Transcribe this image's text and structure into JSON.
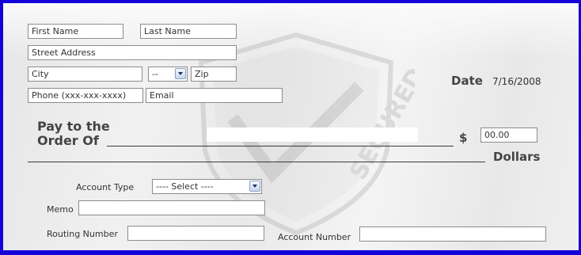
{
  "form": {
    "first_name_placeholder": "First Name",
    "last_name_placeholder": "Last Name",
    "street_placeholder": "Street Address",
    "city_placeholder": "City",
    "state_value": "--",
    "zip_placeholder": "Zip",
    "phone_placeholder": "Phone (xxx-xxx-xxxx)",
    "email_placeholder": "Email"
  },
  "date": {
    "label": "Date",
    "value": "7/16/2008"
  },
  "payee": {
    "label_line1": "Pay to the",
    "label_line2": "Order Of"
  },
  "amount": {
    "currency_symbol": "$",
    "value": "00.00",
    "dollars_label": "Dollars"
  },
  "account_type": {
    "label": "Account Type",
    "selected": "---- Select ----"
  },
  "memo": {
    "label": "Memo"
  },
  "routing": {
    "label": "Routing Number"
  },
  "account_number": {
    "label": "Account Number"
  },
  "watermark": {
    "text": "SECURED"
  },
  "colors": {
    "border": "#1400d8"
  }
}
